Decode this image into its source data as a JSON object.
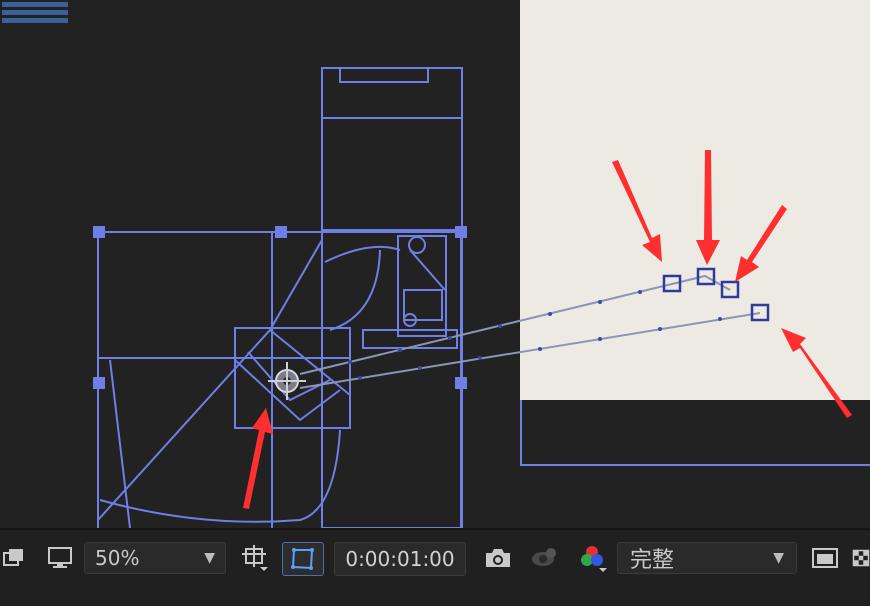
{
  "toolbar": {
    "zoom_value": "50%",
    "timecode": "0:00:01:00",
    "quality_value": "完整"
  },
  "icons": {
    "snapshot_stack": "stack-icon",
    "monitor": "monitor-icon",
    "region": "region-of-interest-icon",
    "mask": "mask-toggle-icon",
    "camera": "camera-icon",
    "show_snapshot": "show-snapshot-icon",
    "channels": "rgb-channel-icon",
    "fast_preview": "fast-preview-icon",
    "transparency_grid": "transparency-grid-icon"
  },
  "colors": {
    "wireframe": "#6f7fe6",
    "arrow": "#ff2f2f",
    "paper": "#eceae3",
    "toolbar": "#202020",
    "accent": "#4d6fb1"
  }
}
